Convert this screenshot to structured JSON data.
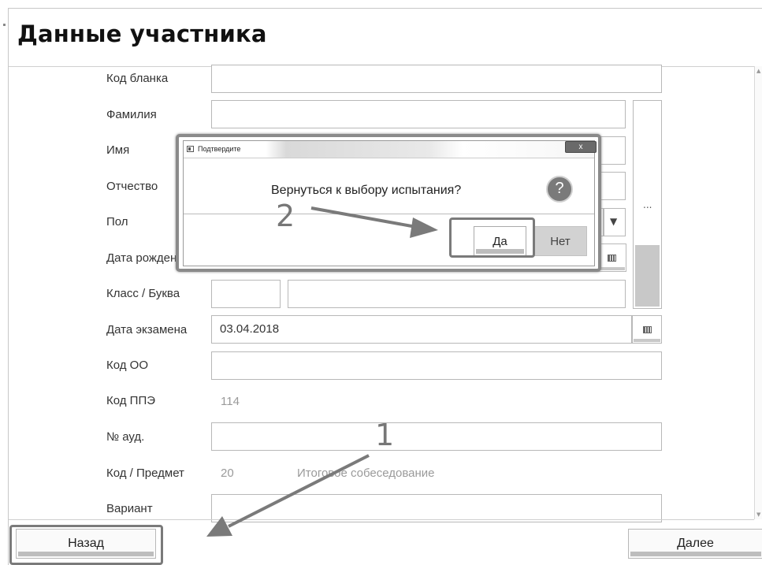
{
  "window": {
    "title": "Данные участника"
  },
  "form": {
    "fields": [
      {
        "label": "Код бланка",
        "value": ""
      },
      {
        "label": "Фамилия",
        "value": ""
      },
      {
        "label": "Имя",
        "value": ""
      },
      {
        "label": "Отчество",
        "value": ""
      },
      {
        "label": "Пол",
        "value": ""
      },
      {
        "label": "Дата рождения",
        "value": ""
      },
      {
        "label": "Класс / Буква",
        "value": ""
      },
      {
        "label": "Дата экзамена",
        "value": "03.04.2018"
      },
      {
        "label": "Код ОО",
        "value": ""
      },
      {
        "label": "Код ППЭ",
        "value": "114"
      },
      {
        "label": "№ ауд.",
        "value": ""
      },
      {
        "label": "Код / Предмет",
        "value": "20",
        "subject": "Итоговое собеседование"
      },
      {
        "label": "Вариант",
        "value": ""
      }
    ],
    "side_button_label": "..."
  },
  "footer": {
    "back_label": "Назад",
    "next_label": "Далее"
  },
  "dialog": {
    "title": "Подтвердите",
    "close_label": "x",
    "message": "Вернуться к выбору испытания?",
    "question_glyph": "?",
    "yes_label": "Да",
    "no_label": "Нет"
  },
  "annotations": {
    "step1": "1",
    "step2": "2"
  },
  "icons": {
    "calendar": "calendar-icon",
    "dropdown": "chevron-down-icon",
    "question": "question-icon",
    "close": "close-icon",
    "app": "app-icon"
  },
  "colors": {
    "highlight": "#7a7a7a",
    "arrow": "#7a7a7a",
    "no_button_bg": "#d2d2d2"
  }
}
